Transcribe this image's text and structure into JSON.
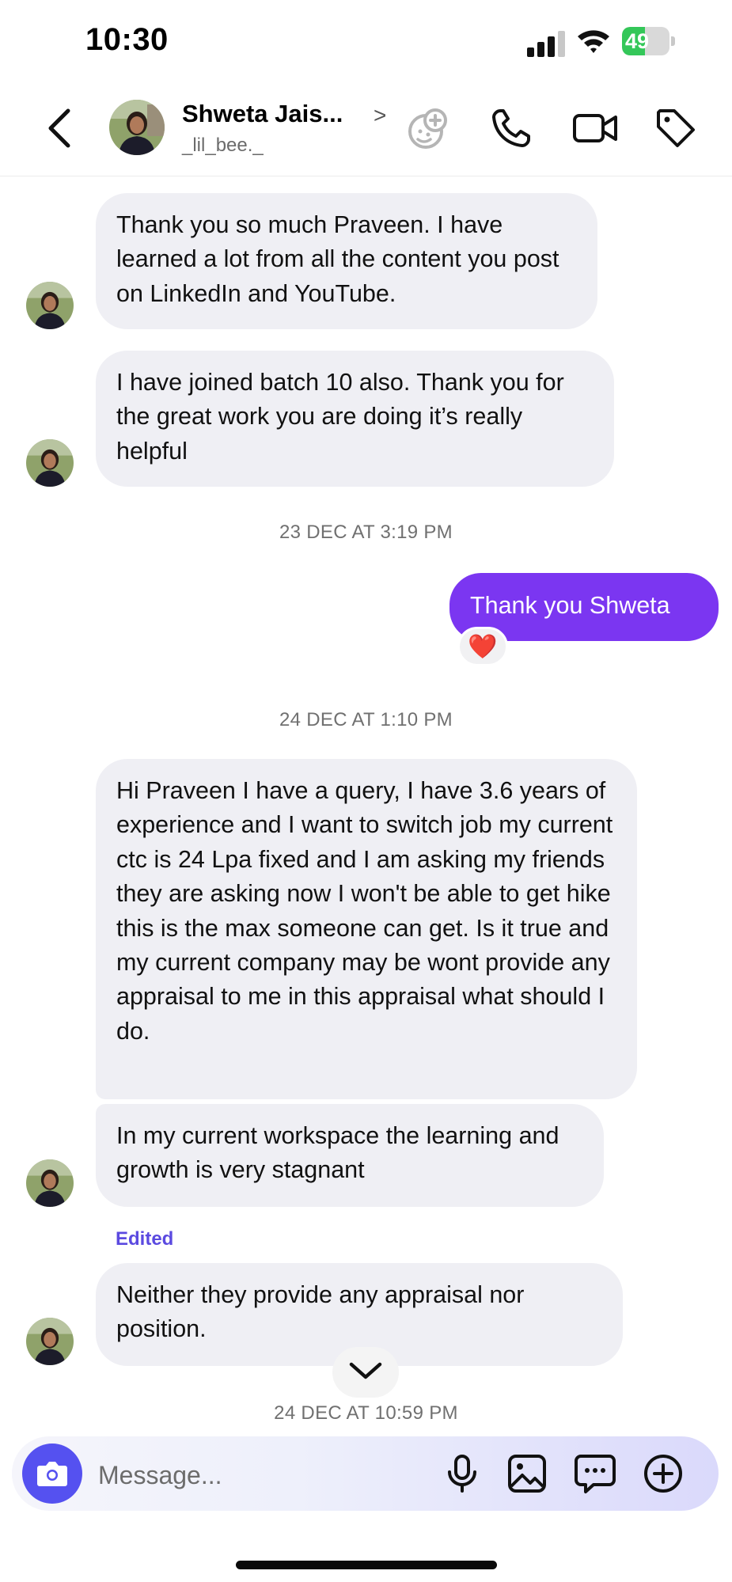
{
  "status_bar": {
    "time": "10:30",
    "battery": "49",
    "battery_level": 0.49
  },
  "header": {
    "name": "Shweta Jais...",
    "username": "_lil_bee._",
    "chevron": ">",
    "icons": [
      "back-chevron-icon",
      "avatar",
      "effects-icon",
      "phone-icon",
      "video-icon",
      "tag-icon"
    ]
  },
  "messages": {
    "m1": "Thank you so much Praveen. I have learned a lot from all the content you post on LinkedIn and YouTube.",
    "m2": "I have joined batch 10 also. Thank you for the great work you are doing it’s really helpful",
    "ts1": "23 DEC AT 3:19 PM",
    "sent1": "Thank you Shweta",
    "reaction": "❤️",
    "ts2": "24 DEC AT 1:10 PM",
    "m3": "Hi Praveen I have a query, I have 3.6 years of experience and I want to switch job my current ctc is 24 Lpa fixed and I am asking my friends they are asking now I won't be able to get hike this is the max someone can get. Is it true and my current company may be wont provide any appraisal to me in this appraisal what should I do.",
    "m4": "In my current workspace the learning and growth is very stagnant",
    "edited": "Edited",
    "m5": "Neither they  provide any appraisal nor position.",
    "ts3": "24 DEC AT 10:59 PM"
  },
  "composer": {
    "placeholder": "Message..."
  },
  "colors": {
    "sent_bubble": "#7b36f1",
    "received_bubble": "#efeff4",
    "camera_button": "#5551f0",
    "edited_label": "#5b4ae0"
  }
}
